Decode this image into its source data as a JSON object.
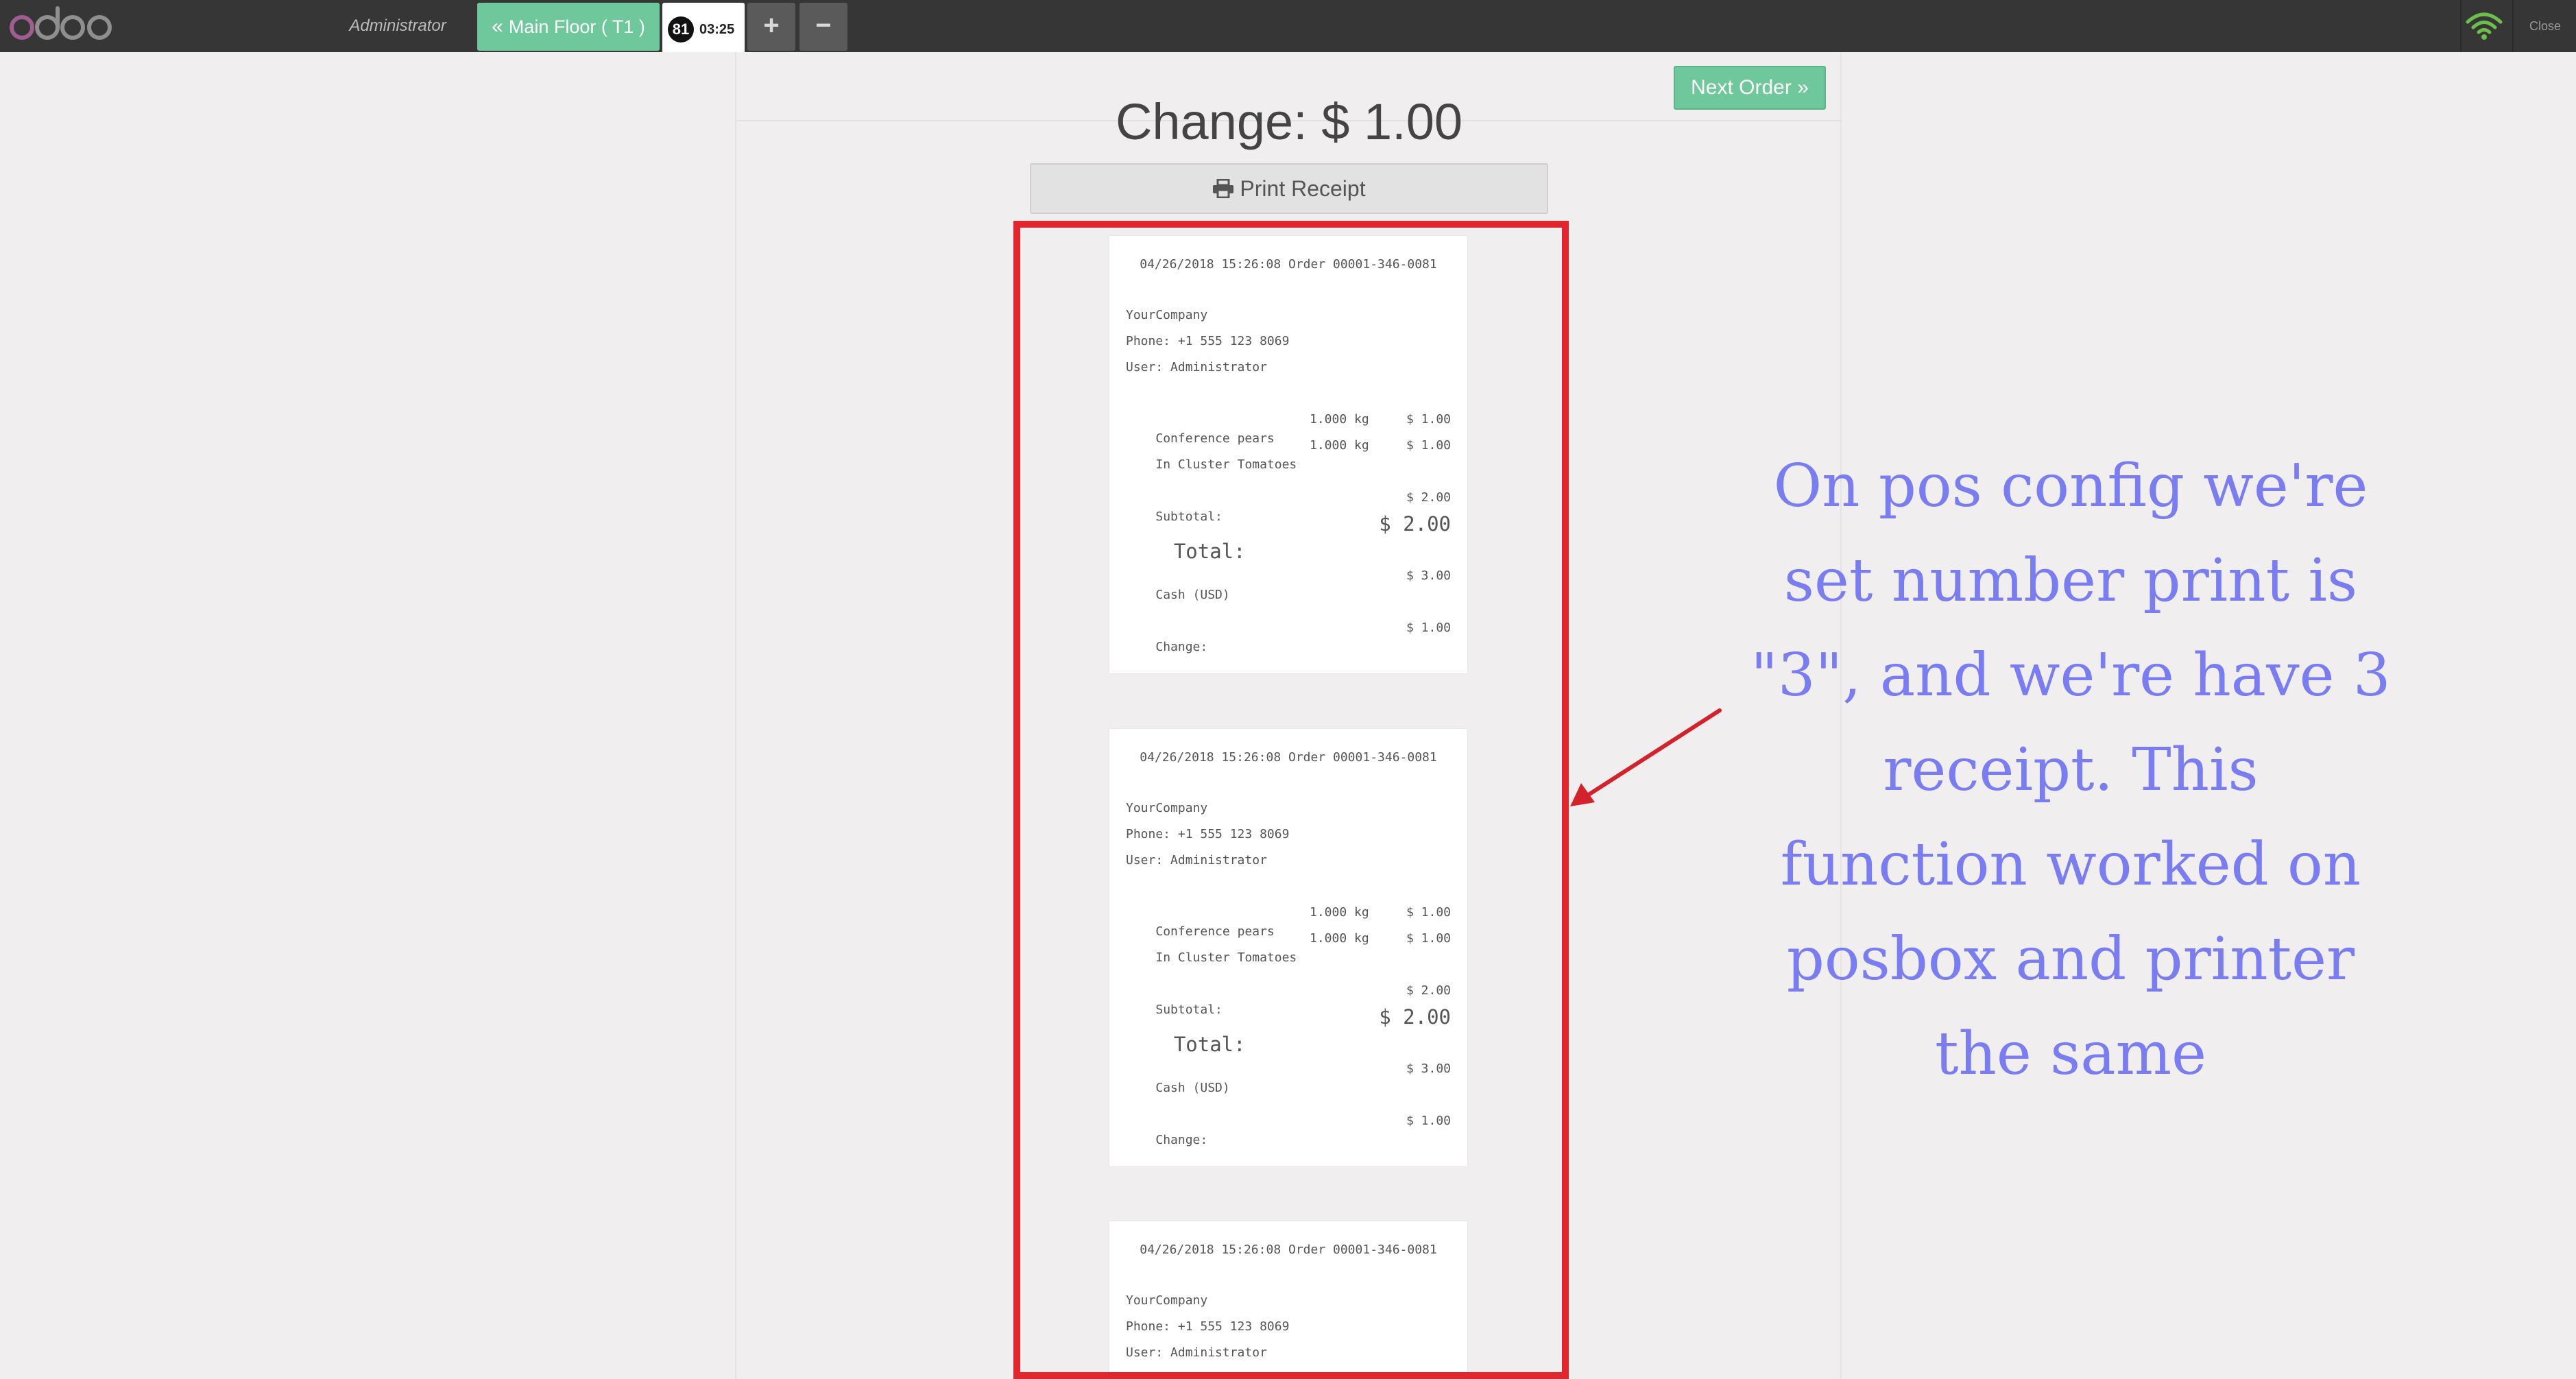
{
  "app": {
    "logo_text": "odoo",
    "cashier": "Administrator",
    "floor_button": "Main Floor ( T1 )",
    "order_number": "81",
    "order_time": "03:25",
    "add_order": "+",
    "remove_order": "−",
    "close_label": "Close",
    "colors": {
      "topbar": "#363636",
      "accent_green": "#6ec89b",
      "highlight_red": "#e3262d",
      "note_blue": "#7a7cf2",
      "wifi_green": "#6cc04a"
    }
  },
  "screen": {
    "change_label": "Change: $ 1.00",
    "next_order_label": "Next Order",
    "print_receipt_label": "Print Receipt"
  },
  "receipt": {
    "header": "04/26/2018 15:26:08 Order 00001-346-0081",
    "company": "YourCompany",
    "phone": "Phone: +1 555 123 8069",
    "user": "User: Administrator",
    "lines": [
      {
        "product": "Conference pears",
        "qty": "1.000 kg",
        "price": "$ 1.00"
      },
      {
        "product": "In Cluster Tomatoes",
        "qty": "1.000 kg",
        "price": "$ 1.00"
      }
    ],
    "subtotal_label": "Subtotal:",
    "subtotal_value": "$ 2.00",
    "total_label": "Total:",
    "total_value": "$ 2.00",
    "payment_label": "Cash (USD)",
    "payment_value": "$ 3.00",
    "change_label": "Change:",
    "change_value": "$ 1.00"
  },
  "annotation": {
    "lines": [
      "On pos config we're",
      "set number print is",
      "\"3\", and we're have 3",
      "receipt. This",
      "function worked on",
      "posbox and printer",
      "the same"
    ]
  }
}
